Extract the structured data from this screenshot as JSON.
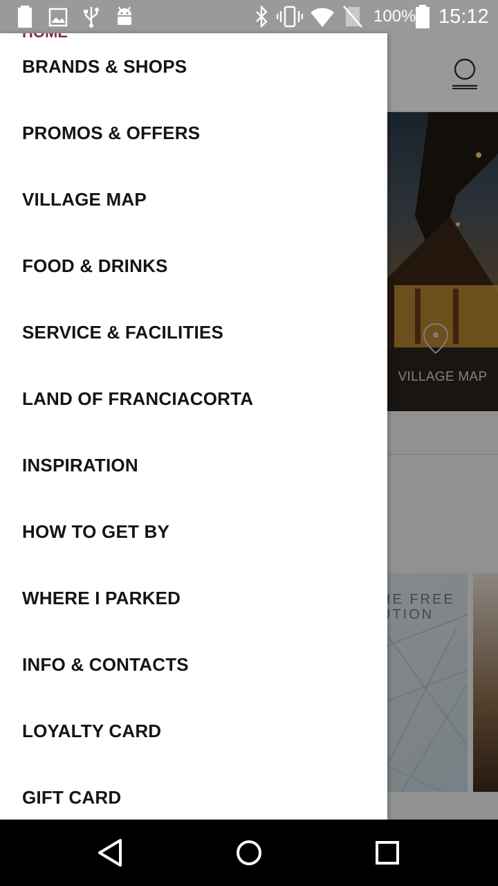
{
  "status_bar": {
    "battery_percent": "100%",
    "time": "15:12",
    "icons": [
      "battery-icon",
      "image-icon",
      "usb-icon",
      "android-icon",
      "bluetooth-icon",
      "vibrate-icon",
      "wifi-icon",
      "no-sim-icon",
      "battery-full-icon"
    ]
  },
  "background": {
    "header_peek_label": "HOME",
    "hero_label": "VILLAGE MAP",
    "promo_text_line1": "HE FREE",
    "promo_text_line2": "UTION"
  },
  "drawer": {
    "items": [
      {
        "label": "BRANDS & SHOPS"
      },
      {
        "label": "PROMOS & OFFERS"
      },
      {
        "label": "VILLAGE MAP"
      },
      {
        "label": "FOOD & DRINKS"
      },
      {
        "label": "SERVICE & FACILITIES"
      },
      {
        "label": "LAND OF FRANCIACORTA"
      },
      {
        "label": "INSPIRATION"
      },
      {
        "label": "HOW TO GET BY"
      },
      {
        "label": "WHERE I PARKED"
      },
      {
        "label": "INFO & CONTACTS"
      },
      {
        "label": "LOYALTY CARD"
      },
      {
        "label": "GIFT CARD"
      }
    ]
  },
  "nav_bar": {
    "buttons": [
      "back-icon",
      "home-icon",
      "recents-icon"
    ]
  },
  "colors": {
    "status_bar": "#9a9a9a",
    "drawer_bg": "#ffffff",
    "drawer_text": "#141414",
    "nav_bar": "#000000",
    "accent": "#8e2a3c"
  }
}
